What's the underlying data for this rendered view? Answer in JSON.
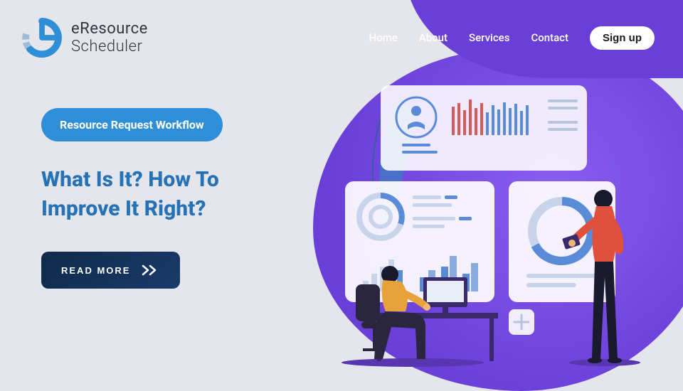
{
  "logo": {
    "line1": "eResource",
    "line2": "Scheduler"
  },
  "nav": {
    "items": [
      "Home",
      "About",
      "Services",
      "Contact"
    ],
    "signup": "Sign up"
  },
  "hero": {
    "pill": "Resource Request Workflow",
    "heading": "What Is It? How To Improve It Right?",
    "cta": "READ MORE"
  }
}
